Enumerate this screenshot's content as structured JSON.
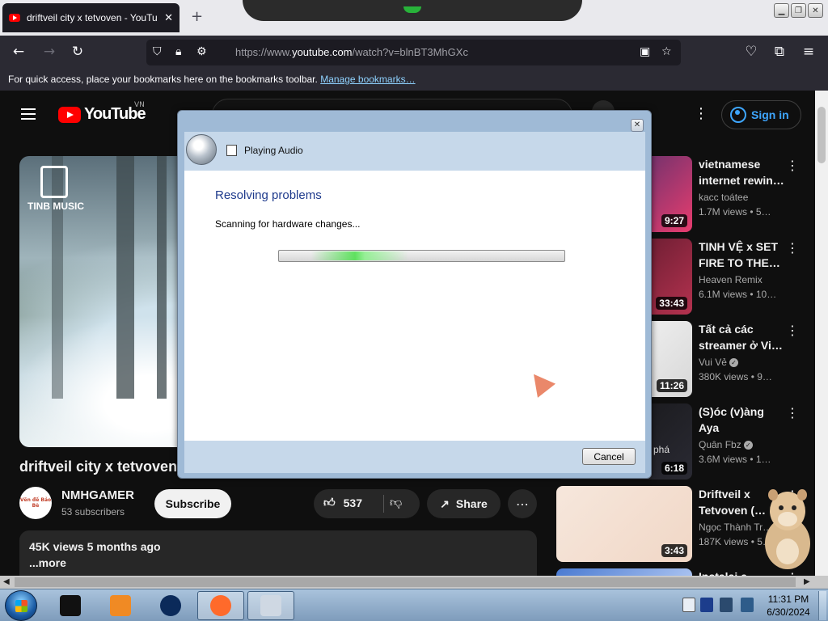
{
  "browser": {
    "tab_title": "driftveil city x tetvoven - YouTube",
    "new_tab": "+",
    "close_tab": "✕",
    "url_prefix": "https://www.",
    "url_domain": "youtube.com",
    "url_path": "/watch?v=blnBT3MhGXc",
    "bookmarks_hint": "For quick access, place your bookmarks here on the bookmarks toolbar.",
    "bookmarks_link": "Manage bookmarks…",
    "window_controls": [
      "▁",
      "❐",
      "✕"
    ]
  },
  "youtube": {
    "logo_text": "YouTube",
    "country": "VN",
    "sign_in": "Sign in",
    "player_badge": "TINB MUSIC",
    "video_title": "driftveil city x tetvoven",
    "channel": {
      "name": "NMHGAMER",
      "subscribers": "53 subscribers",
      "avatar_text": "Vẽn đề Bảo Bè"
    },
    "subscribe": "Subscribe",
    "likes": "537",
    "share": "Share",
    "description": {
      "meta": "45K views  5 months ago",
      "more": "...more"
    },
    "recommendations": [
      {
        "title": "vietnamese internet rewin…",
        "channel": "kacc toátee",
        "stats": "1.7M views  • 5…",
        "duration": "9:27",
        "verified": false,
        "colors": [
          "#1b2a6b",
          "#e83d6f"
        ]
      },
      {
        "title": "TINH VỆ x SET FIRE TO THE…",
        "channel": "Heaven Remix",
        "stats": "6.1M views  • 10…",
        "duration": "33:43",
        "verified": false,
        "colors": [
          "#3a0f1e",
          "#b4324f"
        ]
      },
      {
        "title": "Tất cả các streamer ở Vi…",
        "channel": "Vui Vẻ",
        "stats": "380K views  • 9…",
        "duration": "11:26",
        "verified": true,
        "colors": [
          "#ffffff",
          "#d7d7d7"
        ]
      },
      {
        "title": "(S)óc (v)àng Aya",
        "channel": "Quân Fbz",
        "stats": "3.6M views  • 1…",
        "duration": "6:18",
        "verified": true,
        "colors": [
          "#111111",
          "#2a2a33"
        ],
        "thumb_text": "phá"
      },
      {
        "title": "Driftveil x Tetvoven (…",
        "channel": "Ngọc Thành Tr…",
        "stats": "187K views  • 5…",
        "duration": "3:43",
        "verified": false,
        "colors": [
          "#f6e7dc",
          "#f1d7c6"
        ]
      },
      {
        "title": "Instalai e",
        "channel": "",
        "stats": "",
        "duration": "",
        "verified": false,
        "colors": [
          "#4a7ad1",
          "#d6e4ff"
        ]
      }
    ]
  },
  "dialog": {
    "title": "Playing Audio",
    "heading": "Resolving problems",
    "status": "Scanning for hardware changes...",
    "cancel": "Cancel",
    "close": "✕"
  },
  "taskbar": {
    "time": "11:31 PM",
    "date": "6/30/2024",
    "apps": [
      {
        "name": "terminal",
        "color": "#111111",
        "active": false
      },
      {
        "name": "media-player",
        "color": "#f08a24",
        "active": false
      },
      {
        "name": "globe",
        "color": "#0b2a5a",
        "active": false
      },
      {
        "name": "firefox",
        "color": "#ff6a2b",
        "active": true
      },
      {
        "name": "troubleshooter",
        "color": "#cfd8e3",
        "active": true
      }
    ]
  },
  "colors": {
    "youtube_red": "#ff0000",
    "link_blue": "#3ea6ff",
    "dialog_heading": "#1e3a8c"
  }
}
